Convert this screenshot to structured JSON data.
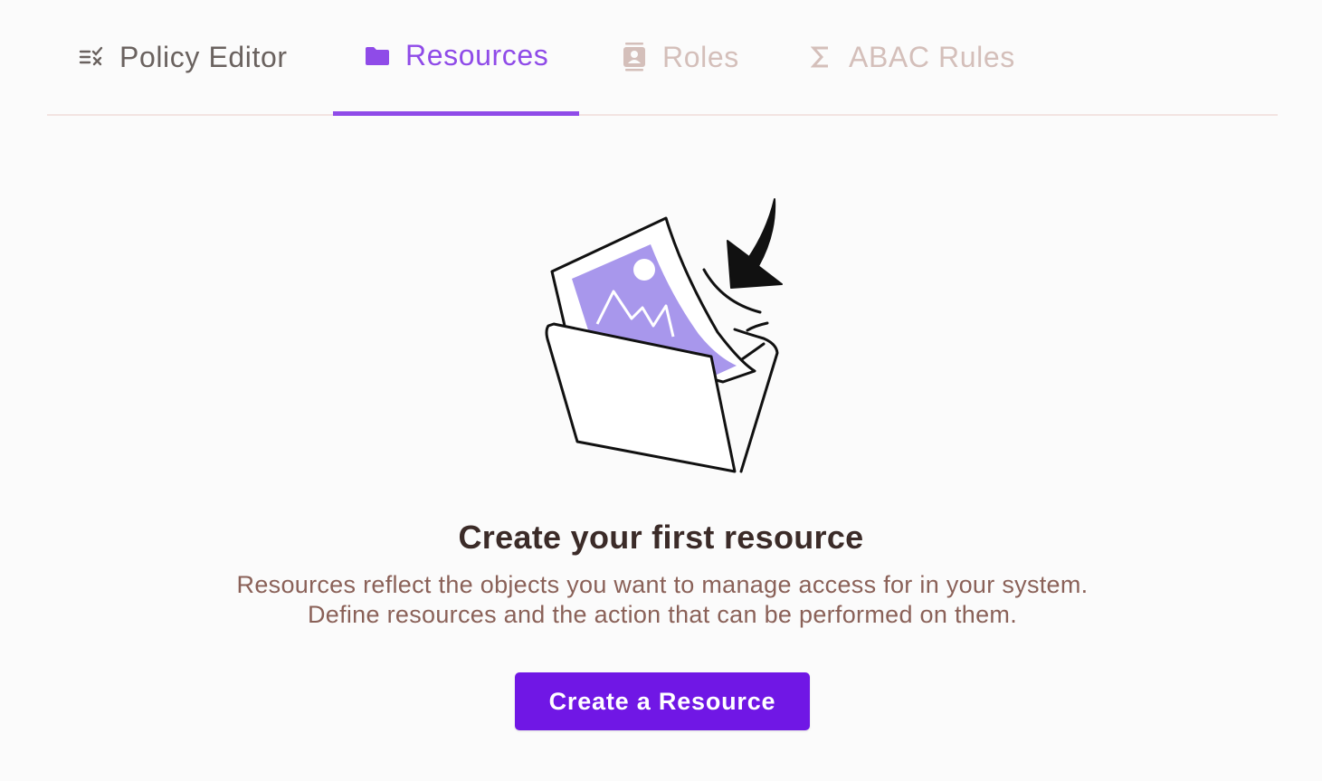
{
  "tabs": [
    {
      "label": "Policy Editor",
      "icon": "list-check-icon",
      "state": "default"
    },
    {
      "label": "Resources",
      "icon": "folder-icon",
      "state": "active"
    },
    {
      "label": "Roles",
      "icon": "contact-card-icon",
      "state": "disabled"
    },
    {
      "label": "ABAC Rules",
      "icon": "sigma-icon",
      "state": "disabled"
    }
  ],
  "empty_state": {
    "illustration": "folder-with-image-illustration",
    "title": "Create your first resource",
    "description": "Resources reflect the objects you want to manage access for in your system. Define resources and the action that can be performed on them.",
    "button_label": "Create a Resource"
  },
  "colors": {
    "accent": "#8f4be8",
    "button": "#7017e5",
    "title": "#3b2b28",
    "description": "#8a6158",
    "tab_default": "#6a625f",
    "tab_disabled": "#d4bfba",
    "illustration_fill": "#a897ec"
  }
}
